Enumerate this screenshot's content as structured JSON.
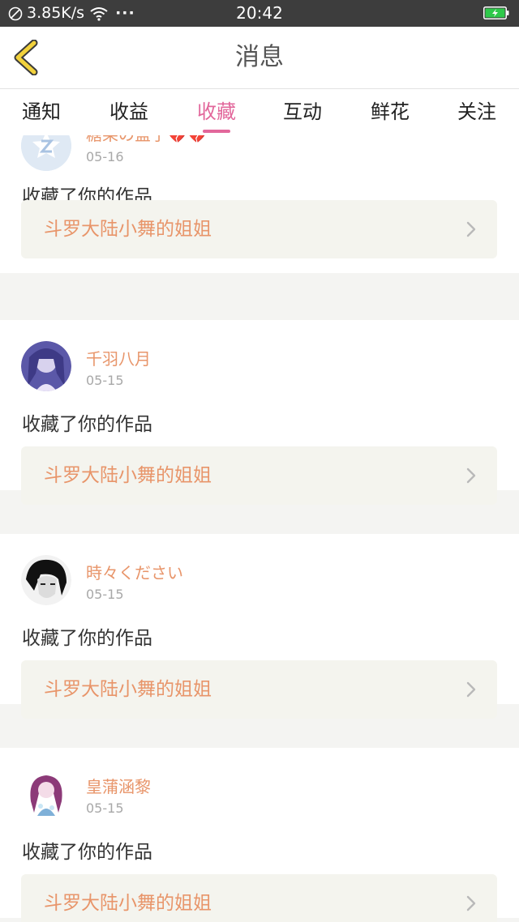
{
  "status_bar": {
    "speed": "3.85K/s",
    "dots": "···",
    "time": "20:42",
    "battery_color": "#2ec94a"
  },
  "header": {
    "title": "消息",
    "back_icon": "chevron-left-icon",
    "accent_color": "#f2d23c"
  },
  "tabs": [
    {
      "label": "通知"
    },
    {
      "label": "收益"
    },
    {
      "label": "收藏",
      "active": true
    },
    {
      "label": "互动"
    },
    {
      "label": "鲜花"
    },
    {
      "label": "关注"
    }
  ],
  "active_tab_color": "#e2679b",
  "username_color": "#e8956a",
  "notifications": [
    {
      "username": "糖果の盒子💔💔",
      "date": "05-16",
      "action": "收藏了你的作品",
      "work_title": "斗罗大陆小舞的姐姐"
    },
    {
      "username": "千羽八月",
      "date": "05-15",
      "action": "收藏了你的作品",
      "work_title": "斗罗大陆小舞的姐姐"
    },
    {
      "username": "時々ください",
      "date": "05-15",
      "action": "收藏了你的作品",
      "work_title": "斗罗大陆小舞的姐姐"
    },
    {
      "username": "皇蒲涵黎",
      "date": "05-15",
      "action": "收藏了你的作品",
      "work_title": "斗罗大陆小舞的姐姐"
    }
  ]
}
